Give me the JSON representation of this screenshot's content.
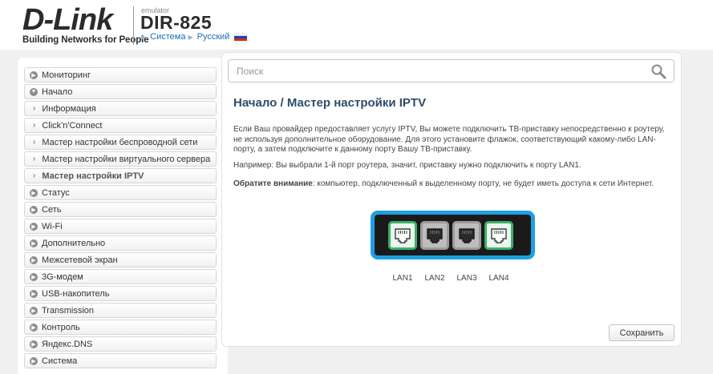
{
  "header": {
    "logo_main": "D-Link",
    "logo_sub": "Building Networks for People",
    "emulator": "emulator",
    "model": "DIR-825",
    "crumb_system": "Система",
    "crumb_language": "Русский"
  },
  "search": {
    "placeholder": "Поиск"
  },
  "sidebar": {
    "items": [
      {
        "label": "Мониторинг",
        "type": "top"
      },
      {
        "label": "Начало",
        "type": "top-open"
      },
      {
        "label": "Информация",
        "type": "sub"
      },
      {
        "label": "Click'n'Connect",
        "type": "sub"
      },
      {
        "label": "Мастер настройки беспроводной сети",
        "type": "sub"
      },
      {
        "label": "Мастер настройки виртуального сервера",
        "type": "sub"
      },
      {
        "label": "Мастер настройки IPTV",
        "type": "sub-active"
      },
      {
        "label": "Статус",
        "type": "top"
      },
      {
        "label": "Сеть",
        "type": "top"
      },
      {
        "label": "Wi-Fi",
        "type": "top"
      },
      {
        "label": "Дополнительно",
        "type": "top"
      },
      {
        "label": "Межсетевой экран",
        "type": "top"
      },
      {
        "label": "3G-модем",
        "type": "top"
      },
      {
        "label": "USB-накопитель",
        "type": "top"
      },
      {
        "label": "Transmission",
        "type": "top"
      },
      {
        "label": "Контроль",
        "type": "top"
      },
      {
        "label": "Яндекс.DNS",
        "type": "top"
      },
      {
        "label": "Система",
        "type": "top"
      }
    ]
  },
  "main": {
    "title": "Начало /  Мастер настройки IPTV",
    "para1": "Если Ваш провайдер предоставляет услугу IPTV, Вы можете подключить ТВ-приставку непосредственно к роутеру, не используя дополнительное оборудование. Для этого установите флажок, соответствующий какому-либо LAN-порту, а затем подключите к данному порту Вашу ТВ-приставку.",
    "para2": "Например: Вы выбрали 1-й порт роутера, значит, приставку нужно подключить к порту LAN1.",
    "para3_bold": "Обратите внимание",
    "para3_rest": ": компьютер, подключенный к выделенному порту, не будет иметь доступа к сети Интернет.",
    "save_label": "Сохранить"
  },
  "ports": [
    {
      "label": "LAN1",
      "selected": true
    },
    {
      "label": "LAN2",
      "selected": false
    },
    {
      "label": "LAN3",
      "selected": false
    },
    {
      "label": "LAN4",
      "selected": true
    }
  ],
  "colors": {
    "accent": "#1da0e3",
    "port_selected": "#3cb06a",
    "title": "#2f4c6a",
    "link": "#1b6fb3"
  }
}
